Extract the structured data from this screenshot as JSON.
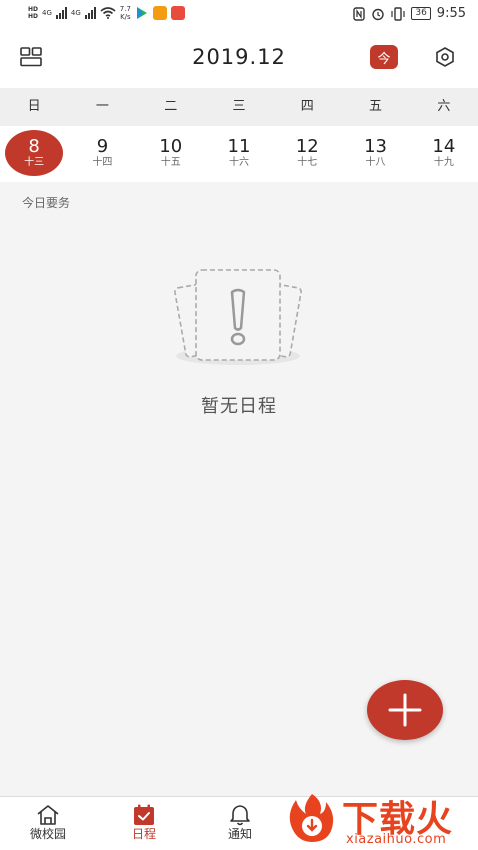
{
  "status_bar": {
    "net_label_1": "HD",
    "net_label_2": "HD",
    "signal_1": "4G",
    "signal_2": "4G",
    "speed_value": "7.7",
    "speed_unit": "K/s",
    "battery": "36",
    "time": "9:55",
    "icons": [
      "nfc-icon",
      "alarm-icon",
      "vibrate-icon"
    ]
  },
  "header": {
    "title": "2019.12",
    "today_label": "今"
  },
  "weekdays": [
    "日",
    "一",
    "二",
    "三",
    "四",
    "五",
    "六"
  ],
  "dates": [
    {
      "day": "8",
      "lunar": "十三",
      "selected": true
    },
    {
      "day": "9",
      "lunar": "十四"
    },
    {
      "day": "10",
      "lunar": "十五"
    },
    {
      "day": "11",
      "lunar": "十六"
    },
    {
      "day": "12",
      "lunar": "十七"
    },
    {
      "day": "13",
      "lunar": "十八"
    },
    {
      "day": "14",
      "lunar": "十九"
    }
  ],
  "section_label": "今日要务",
  "empty_text": "暂无日程",
  "tabs": [
    {
      "label": "微校园",
      "icon": "home-icon"
    },
    {
      "label": "日程",
      "icon": "calendar-check-icon",
      "active": true
    },
    {
      "label": "通知",
      "icon": "bell-icon"
    }
  ],
  "watermark": {
    "text": "下载火",
    "url": "xiazaihuo.com"
  },
  "colors": {
    "accent": "#c0392b",
    "watermark": "#e8431f"
  }
}
